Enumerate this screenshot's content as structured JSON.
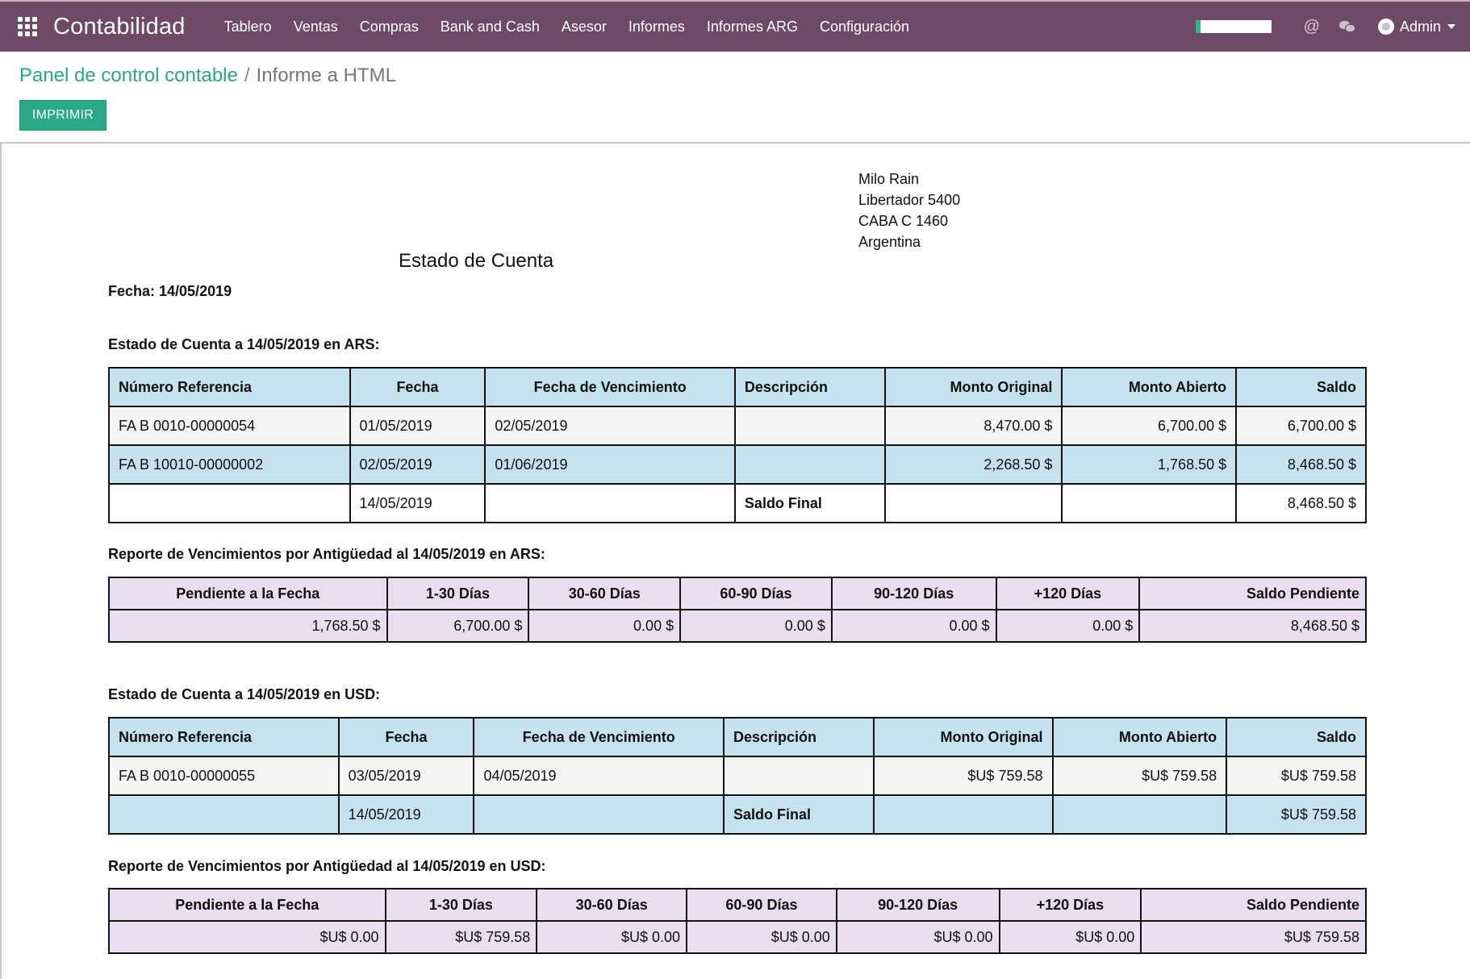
{
  "navbar": {
    "app_title": "Contabilidad",
    "menu": [
      "Tablero",
      "Ventas",
      "Compras",
      "Bank and Cash",
      "Asesor",
      "Informes",
      "Informes ARG",
      "Configuración"
    ],
    "user": "Admin",
    "at_symbol": "@",
    "accent_color": "#6f4a68"
  },
  "breadcrumb": {
    "parent": "Panel de control contable",
    "separator": "/",
    "current": "Informe a HTML"
  },
  "actions": {
    "print": "IMPRIMIR"
  },
  "report": {
    "address": [
      "Milo Rain",
      "Libertador 5400",
      "CABA C 1460",
      "Argentina"
    ],
    "title": "Estado de Cuenta",
    "date_line": "Fecha: 14/05/2019",
    "ars": {
      "title": "Estado de Cuenta a 14/05/2019 en ARS:",
      "headers": [
        "Número Referencia",
        "Fecha",
        "Fecha de Vencimiento",
        "Descripción",
        "Monto Original",
        "Monto Abierto",
        "Saldo"
      ],
      "rows": [
        [
          "FA B 0010-00000054",
          "01/05/2019",
          "02/05/2019",
          "",
          "8,470.00 $",
          "6,700.00 $",
          "6,700.00 $"
        ],
        [
          "FA B 10010-00000002",
          "02/05/2019",
          "01/06/2019",
          "",
          "2,268.50 $",
          "1,768.50 $",
          "8,468.50 $"
        ],
        [
          "",
          "14/05/2019",
          "",
          "Saldo Final",
          "",
          "",
          "8,468.50 $"
        ]
      ],
      "aging_title": "Reporte de Vencimientos por Antigüedad al 14/05/2019 en ARS:",
      "aging_headers": [
        "Pendiente a la Fecha",
        "1-30 Días",
        "30-60 Días",
        "60-90 Días",
        "90-120 Días",
        "+120 Días",
        "Saldo Pendiente"
      ],
      "aging_values": [
        "1,768.50 $",
        "6,700.00 $",
        "0.00 $",
        "0.00 $",
        "0.00 $",
        "0.00 $",
        "8,468.50 $"
      ]
    },
    "usd": {
      "title": "Estado de Cuenta a 14/05/2019 en USD:",
      "headers": [
        "Número Referencia",
        "Fecha",
        "Fecha de Vencimiento",
        "Descripción",
        "Monto Original",
        "Monto Abierto",
        "Saldo"
      ],
      "rows": [
        [
          "FA B 0010-00000055",
          "03/05/2019",
          "04/05/2019",
          "",
          "$U$ 759.58",
          "$U$ 759.58",
          "$U$ 759.58"
        ],
        [
          "",
          "14/05/2019",
          "",
          "Saldo Final",
          "",
          "",
          "$U$ 759.58"
        ]
      ],
      "aging_title": "Reporte de Vencimientos por Antigüedad al 14/05/2019 en USD:",
      "aging_headers": [
        "Pendiente a la Fecha",
        "1-30 Días",
        "30-60 Días",
        "60-90 Días",
        "90-120 Días",
        "+120 Días",
        "Saldo Pendiente"
      ],
      "aging_values": [
        "$U$ 0.00",
        "$U$ 759.58",
        "$U$ 0.00",
        "$U$ 0.00",
        "$U$ 0.00",
        "$U$ 0.00",
        "$U$ 759.58"
      ]
    }
  }
}
